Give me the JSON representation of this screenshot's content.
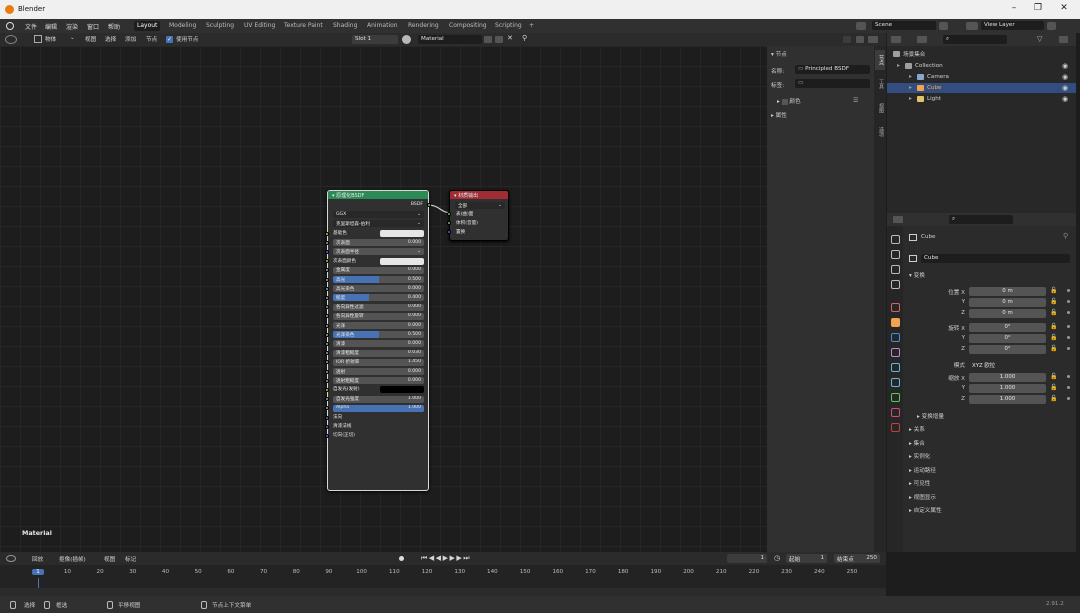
{
  "window": {
    "title": "Blender",
    "minimize": "–",
    "maximize": "❐",
    "close": "✕"
  },
  "menu": {
    "file": "文件",
    "edit": "编辑",
    "render": "渲染",
    "window": "窗口",
    "help": "帮助"
  },
  "workspaces": [
    "Layout",
    "Modeling",
    "Sculpting",
    "UV Editing",
    "Texture Paint",
    "Shading",
    "Animation",
    "Rendering",
    "Compositing",
    "Scripting",
    "+"
  ],
  "scene": {
    "name": "Scene",
    "view_layer": "View Layer"
  },
  "node_header": {
    "object_mode": "物体",
    "view": "视图",
    "select": "选择",
    "add": "添加",
    "node": "节点",
    "use_nodes": "使用节点",
    "slot": "Slot 1",
    "material": "Material"
  },
  "canvas": {
    "label": "Material"
  },
  "bsdf_node": {
    "title": "原理化BSDF",
    "output": "BSDF",
    "distribution": "GGX",
    "subsurface_method": "克里斯坦森-伯利",
    "rows": [
      {
        "label": "基础色",
        "kind": "color",
        "color": "#e6e6e6"
      },
      {
        "label": "次表面",
        "kind": "slider",
        "value": "0.000",
        "fill": 0
      },
      {
        "label": "次表面半径",
        "kind": "dropdown"
      },
      {
        "label": "次表面颜色",
        "kind": "color",
        "color": "#e6e6e6"
      },
      {
        "label": "金属度",
        "kind": "slider",
        "value": "0.000",
        "fill": 0
      },
      {
        "label": "高光",
        "kind": "slider",
        "value": "0.500",
        "fill": 0.5,
        "active": true
      },
      {
        "label": "高光染色",
        "kind": "slider",
        "value": "0.000",
        "fill": 0
      },
      {
        "label": "糙度",
        "kind": "slider",
        "value": "0.400",
        "fill": 0.4,
        "active": true
      },
      {
        "label": "各向异性过滤",
        "kind": "slider",
        "value": "0.000",
        "fill": 0
      },
      {
        "label": "各向异性旋转",
        "kind": "slider",
        "value": "0.000",
        "fill": 0
      },
      {
        "label": "光泽",
        "kind": "slider",
        "value": "0.000",
        "fill": 0
      },
      {
        "label": "光泽染色",
        "kind": "slider",
        "value": "0.500",
        "fill": 0.5,
        "active": true
      },
      {
        "label": "清漆",
        "kind": "slider",
        "value": "0.000",
        "fill": 0
      },
      {
        "label": "清漆粗糙度",
        "kind": "slider",
        "value": "0.030",
        "fill": 0.03
      },
      {
        "label": "IOR 折射率",
        "kind": "slider",
        "value": "1.450",
        "fill": 0
      },
      {
        "label": "透射",
        "kind": "slider",
        "value": "0.000",
        "fill": 0
      },
      {
        "label": "透射粗糙度",
        "kind": "slider",
        "value": "0.000",
        "fill": 0
      },
      {
        "label": "自发光(发射)",
        "kind": "color",
        "color": "#000000"
      },
      {
        "label": "自发光强度",
        "kind": "slider",
        "value": "1.000",
        "fill": 0
      },
      {
        "label": "Alpha",
        "kind": "slider",
        "value": "1.000",
        "fill": 1,
        "active": true
      },
      {
        "label": "法向",
        "kind": "text"
      },
      {
        "label": "清漆法线",
        "kind": "text"
      },
      {
        "label": "切向(正切)",
        "kind": "text"
      }
    ]
  },
  "output_node": {
    "title": "材质输出",
    "target": "全部",
    "inputs": [
      "表(曲)面",
      "体积(音量)",
      "置换"
    ]
  },
  "npanel": {
    "section": "节点",
    "name_label": "名称:",
    "name_value": "Principled BSDF",
    "label_label": "标签:",
    "label_value": "",
    "color_section": "颜色",
    "props_section": "属性",
    "tabs": [
      "节点",
      "工具",
      "视图",
      "选项"
    ]
  },
  "outliner": {
    "title": "场景集合",
    "items": [
      {
        "name": "Collection",
        "color": "#9f9f9f"
      },
      {
        "name": "Camera",
        "color": "#8aa6c8"
      },
      {
        "name": "Cube",
        "color": "#f2a350"
      },
      {
        "name": "Light",
        "color": "#e0c36c"
      }
    ]
  },
  "properties": {
    "object": "Cube",
    "object_field": "Cube",
    "transform": "变换",
    "location_label": "位置 X",
    "rotation_label": "旋转 X",
    "scale_label": "缩放 X",
    "mode_label": "模式",
    "mode_value": "XYZ 欧拉",
    "location": [
      "0 m",
      "0 m",
      "0 m"
    ],
    "rotation": [
      "0°",
      "0°",
      "0°"
    ],
    "scale": [
      "1.000",
      "1.000",
      "1.000"
    ],
    "y": "Y",
    "z": "Z",
    "delta": "变换增量",
    "sections": [
      "关系",
      "集合",
      "实例化",
      "运动路径",
      "可见性",
      "视图显示",
      "自定义属性"
    ]
  },
  "timeline": {
    "playback": "回放",
    "keying": "抠像(插帧)",
    "view": "视图",
    "marker": "标记",
    "current": "1",
    "start_label": "起始",
    "start": "1",
    "end_label": "结束点",
    "end": "250",
    "ticks": [
      "1",
      "10",
      "20",
      "30",
      "40",
      "50",
      "60",
      "70",
      "80",
      "90",
      "100",
      "110",
      "120",
      "130",
      "140",
      "150",
      "160",
      "170",
      "180",
      "190",
      "200",
      "210",
      "220",
      "230",
      "240",
      "250"
    ]
  },
  "status": {
    "select": "选择",
    "box": "框选",
    "pan": "平移视图",
    "context": "节点上下文菜单",
    "version": "2.91.2"
  }
}
